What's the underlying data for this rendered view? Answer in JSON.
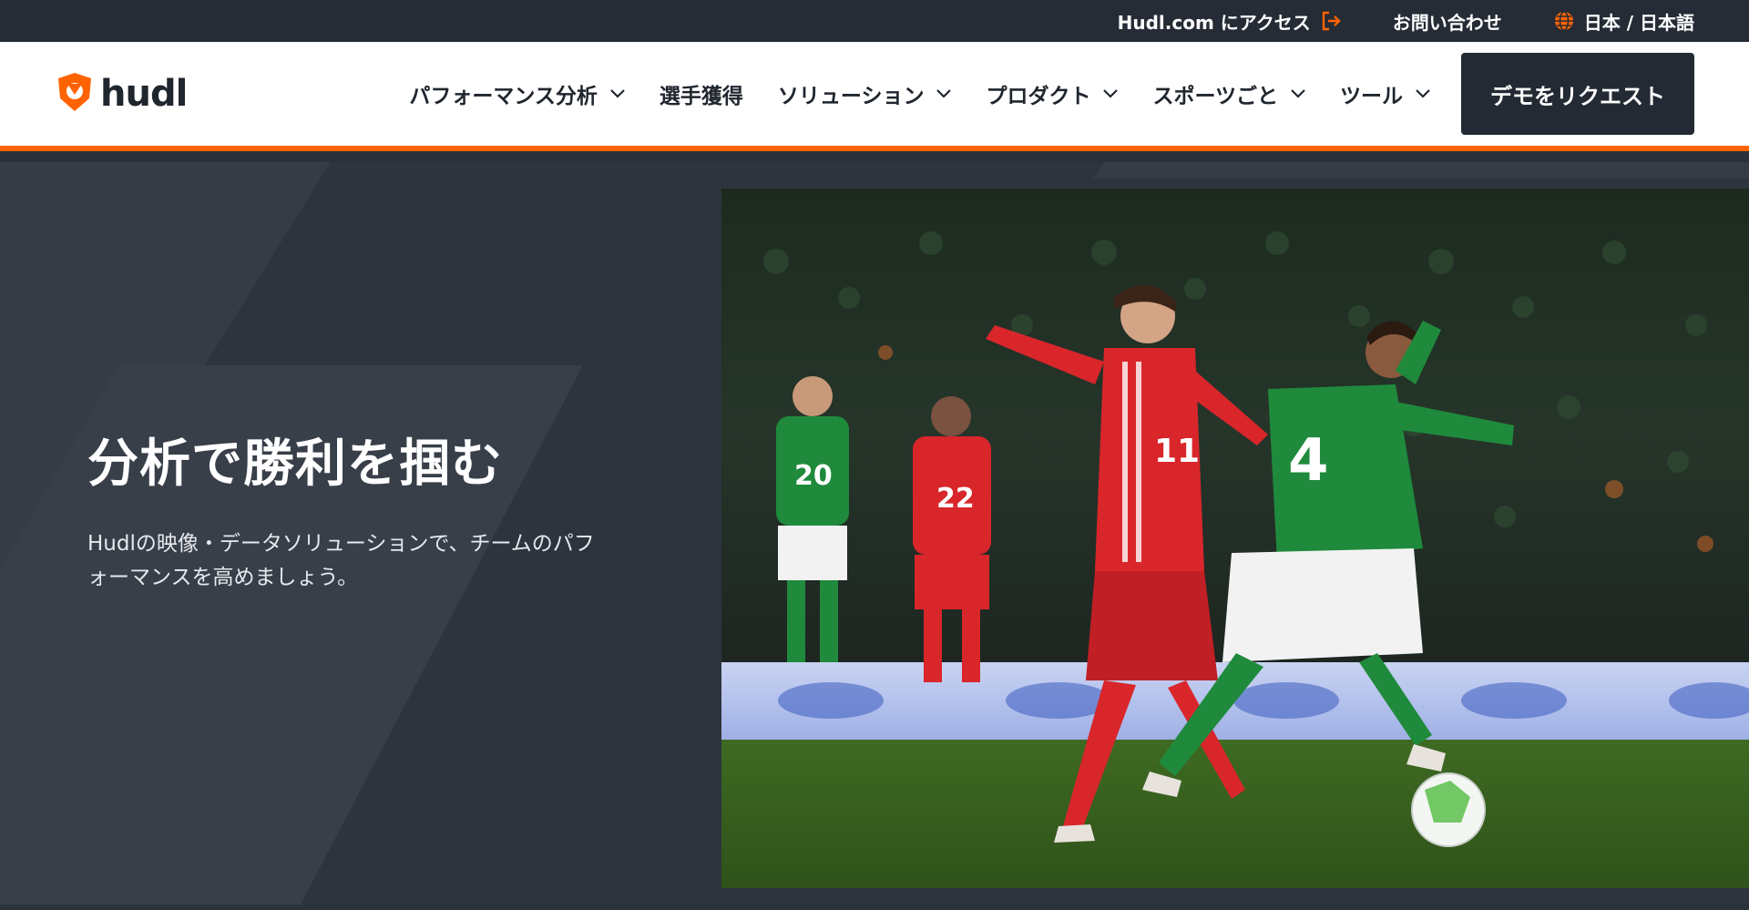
{
  "utility": {
    "access_label": "Hudl.com にアクセス",
    "contact_label": "お問い合わせ",
    "language_label": "日本 / 日本語"
  },
  "brand": {
    "logo_text": "hudl"
  },
  "nav": {
    "items": [
      {
        "label": "パフォーマンス分析",
        "has_dropdown": true
      },
      {
        "label": "選手獲得",
        "has_dropdown": false
      },
      {
        "label": "ソリューション",
        "has_dropdown": true
      },
      {
        "label": "プロダクト",
        "has_dropdown": true
      },
      {
        "label": "スポーツごと",
        "has_dropdown": true
      },
      {
        "label": "ツール",
        "has_dropdown": true
      }
    ],
    "cta_label": "デモをリクエスト"
  },
  "hero": {
    "title": "分析で勝利を掴む",
    "subtitle_line1": "Hudlの映像・データソリューションで、チームのパフ",
    "subtitle_line2": "ォーマンスを高めましょう。",
    "jersey_numbers": [
      "20",
      "22",
      "11",
      "4"
    ]
  },
  "colors": {
    "accent": "#ff6300",
    "dark": "#232a33",
    "hero_bg": "#2d343d",
    "red_kit": "#d8262b",
    "green_kit": "#1f8a3c"
  }
}
